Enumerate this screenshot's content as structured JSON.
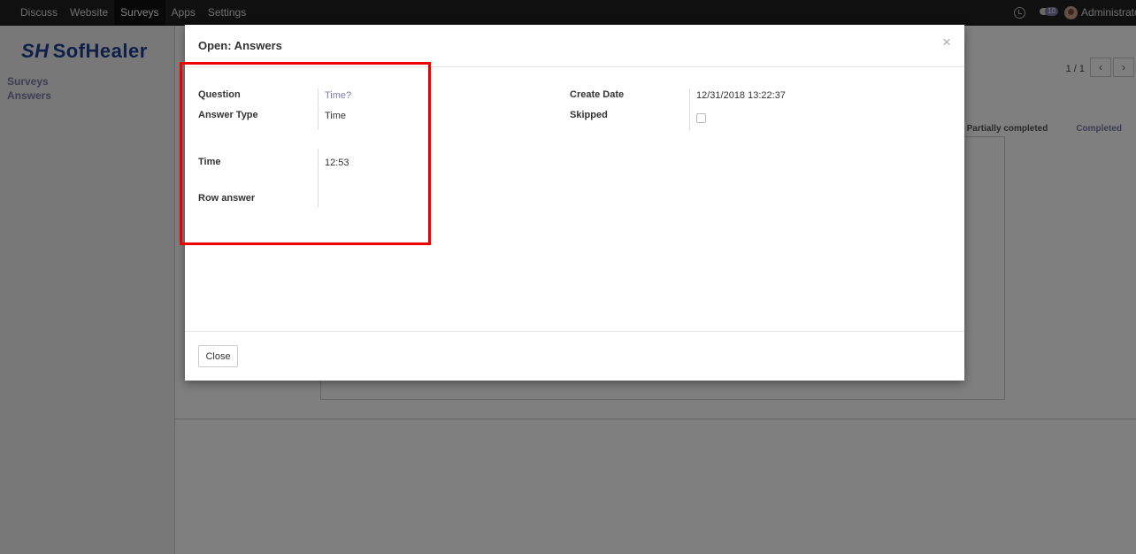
{
  "navbar": {
    "menu": [
      "Discuss",
      "Website",
      "Surveys",
      "Apps",
      "Settings"
    ],
    "active": "Surveys",
    "chat_count": "10",
    "user": "Administrator"
  },
  "sidebar": {
    "logo": "SofHealer",
    "logo_mark": "SH",
    "links": [
      "Surveys",
      "Answers"
    ]
  },
  "background": {
    "pager": "1 / 1",
    "statuses": [
      "Partially completed",
      "Completed"
    ]
  },
  "modal": {
    "title": "Open: Answers",
    "close_glyph": "×",
    "fields": {
      "question_label": "Question",
      "question_value": "Time?",
      "answer_type_label": "Answer Type",
      "answer_type_value": "Time",
      "time_label": "Time",
      "time_value": "12:53",
      "row_answer_label": "Row answer",
      "create_date_label": "Create Date",
      "create_date_value": "12/31/2018 13:22:37",
      "skipped_label": "Skipped",
      "skipped_value": false
    },
    "close_button": "Close"
  },
  "colors": {
    "accent": "#7c7bad",
    "highlight": "#ee0000",
    "navbar": "#212121"
  }
}
